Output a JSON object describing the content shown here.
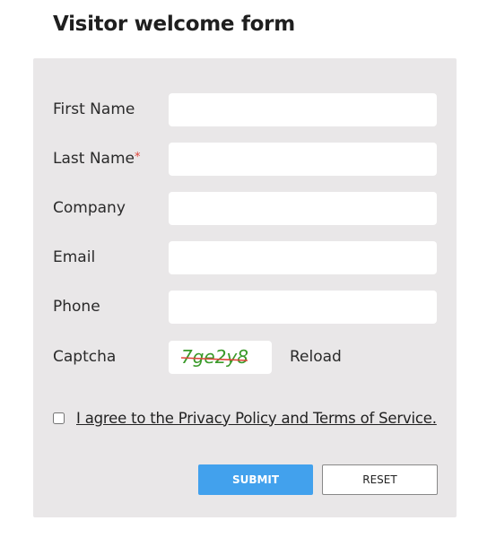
{
  "form": {
    "title": "Visitor welcome form",
    "fields": [
      {
        "label": "First Name",
        "required": false,
        "value": "",
        "placeholder": ""
      },
      {
        "label": "Last Name",
        "required": true,
        "value": "",
        "placeholder": ""
      },
      {
        "label": "Company",
        "required": false,
        "value": "",
        "placeholder": ""
      },
      {
        "label": "Email",
        "required": false,
        "value": "",
        "placeholder": ""
      },
      {
        "label": "Phone",
        "required": false,
        "value": "",
        "placeholder": ""
      }
    ],
    "required_marker": "*",
    "captcha": {
      "label": "Captcha",
      "text": "7ge2y8",
      "text_color": "#3a9a2a",
      "strike_color": "#e0453a",
      "reload_label": "Reload"
    },
    "agreement": {
      "label": "I agree to the Privacy Policy and Terms of Service.",
      "checked": false
    },
    "buttons": {
      "submit_label": "SUBMIT",
      "reset_label": "RESET"
    },
    "colors": {
      "accent": "#42a1ed",
      "panel_bg": "#e9e7e8",
      "required": "#e0453a"
    }
  }
}
